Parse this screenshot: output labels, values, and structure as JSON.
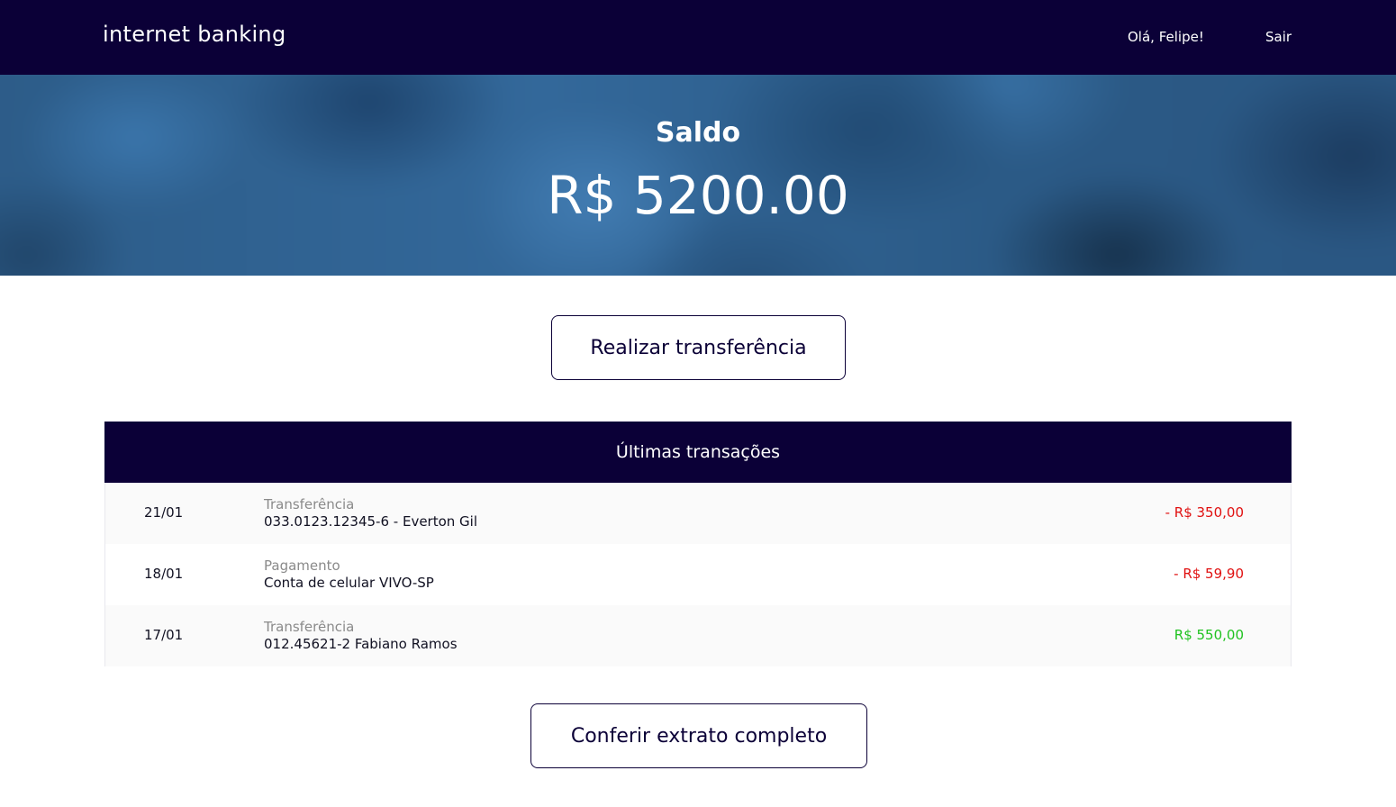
{
  "header": {
    "brand": "internet banking",
    "greeting": "Olá, Felipe!",
    "logout_label": "Sair"
  },
  "balance": {
    "title": "Saldo",
    "amount": "R$ 5200.00"
  },
  "actions": {
    "transfer_label": "Realizar transferência",
    "statement_label": "Conferir extrato completo"
  },
  "transactions": {
    "title": "Últimas transações",
    "items": [
      {
        "date": "21/01",
        "type": "Transferência",
        "description": "033.0123.12345-6 - Everton Gil",
        "amount": "- R$ 350,00",
        "amount_color": "#e01010"
      },
      {
        "date": "18/01",
        "type": "Pagamento",
        "description": "Conta de celular VIVO-SP",
        "amount": "- R$ 59,90",
        "amount_color": "#e01010"
      },
      {
        "date": "17/01",
        "type": "Transferência",
        "description": "012.45621-2 Fabiano Ramos",
        "amount": "R$ 550,00",
        "amount_color": "#1fc21f"
      }
    ]
  },
  "colors": {
    "navy": "#0b0037",
    "negative": "#e01010",
    "positive": "#1fc21f"
  }
}
